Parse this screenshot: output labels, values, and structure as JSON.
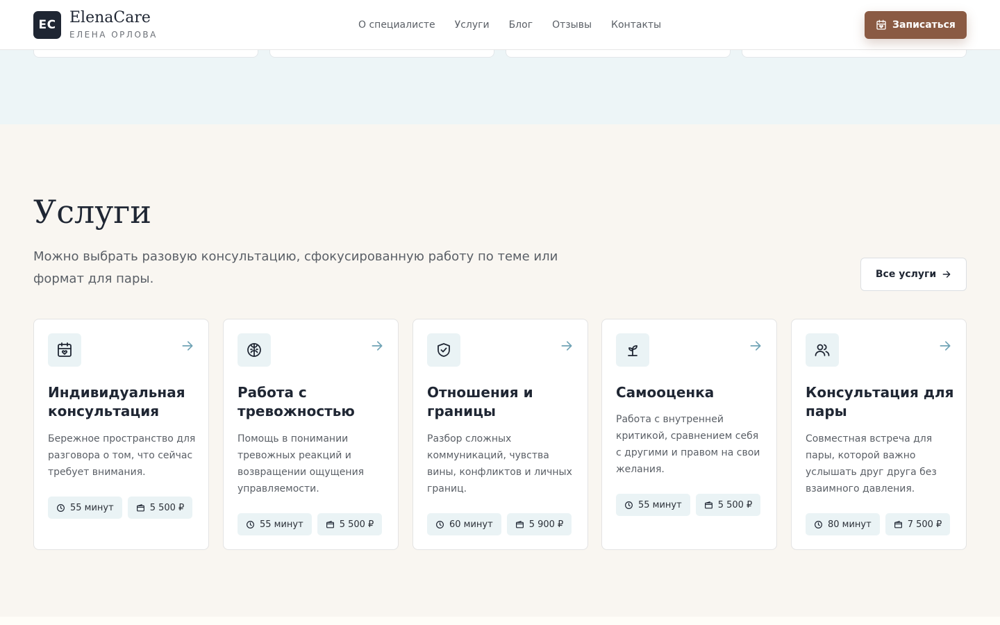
{
  "header": {
    "logo_initials": "EC",
    "logo_name": "ElenaCare",
    "logo_subtitle": "ЕЛЕНА ОРЛОВА",
    "nav": [
      "О специалисте",
      "Услуги",
      "Блог",
      "Отзывы",
      "Контакты"
    ],
    "book_button": "Записаться"
  },
  "services": {
    "title": "Услуги",
    "description": "Можно выбрать разовую консультацию, сфокусированную работу по теме или формат для пары.",
    "all_button": "Все услуги",
    "cards": [
      {
        "icon": "calendar-heart-icon",
        "title": "Индивидуальная консультация",
        "text": "Бережное пространство для разговора о том, что сейчас требует внимания.",
        "duration": "55 минут",
        "price": "5 500 ₽"
      },
      {
        "icon": "brain-icon",
        "title": "Работа с тревожностью",
        "text": "Помощь в понимании тревожных реакций и возвращении ощущения управляемости.",
        "duration": "55 минут",
        "price": "5 500 ₽"
      },
      {
        "icon": "shield-check-icon",
        "title": "Отношения и границы",
        "text": "Разбор сложных коммуникаций, чувства вины, конфликтов и личных границ.",
        "duration": "60 минут",
        "price": "5 900 ₽"
      },
      {
        "icon": "sprout-icon",
        "title": "Самооценка",
        "text": "Работа с внутренней критикой, сравнением себя с другими и правом на свои желания.",
        "duration": "55 минут",
        "price": "5 500 ₽"
      },
      {
        "icon": "users-icon",
        "title": "Консультация для пары",
        "text": "Совместная встреча для пары, которой важно услышать друг друга без взаимного давления.",
        "duration": "80 минут",
        "price": "7 500 ₽"
      }
    ]
  },
  "colors": {
    "accent": "#8a5a43",
    "dark": "#1f2633",
    "icon_bg": "#eaf3f5",
    "arrow": "#6fa3b5",
    "section_bg": "#f9f6f1"
  }
}
